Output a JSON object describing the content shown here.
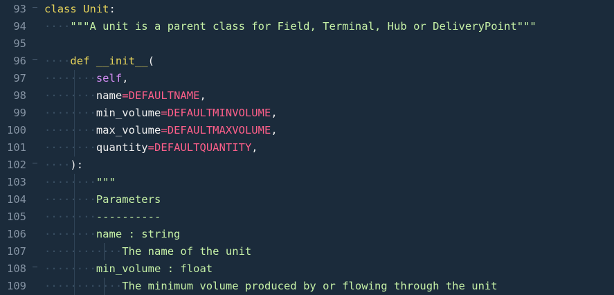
{
  "editor": {
    "lines": [
      {
        "number": "93",
        "fold": true,
        "tokens": [
          {
            "cls": "t-kw",
            "text": "class"
          },
          {
            "cls": "t-name",
            "text": " "
          },
          {
            "cls": "t-cls",
            "text": "Unit"
          },
          {
            "cls": "t-punc",
            "text": ":"
          }
        ]
      },
      {
        "number": "94",
        "fold": false,
        "indent": 1,
        "tokens": [
          {
            "cls": "t-str",
            "text": "\"\"\"A unit is a parent class for Field, Terminal, Hub or DeliveryPoint\"\"\""
          }
        ]
      },
      {
        "number": "95",
        "fold": false,
        "tokens": []
      },
      {
        "number": "96",
        "fold": true,
        "indent": 1,
        "tokens": [
          {
            "cls": "t-def",
            "text": "def"
          },
          {
            "cls": "t-name",
            "text": " "
          },
          {
            "cls": "t-fn",
            "text": "__init__"
          },
          {
            "cls": "t-punc",
            "text": "("
          }
        ]
      },
      {
        "number": "97",
        "fold": false,
        "indent": 2,
        "tokens": [
          {
            "cls": "t-self",
            "text": "self"
          },
          {
            "cls": "t-punc",
            "text": ","
          }
        ]
      },
      {
        "number": "98",
        "fold": false,
        "indent": 2,
        "tokens": [
          {
            "cls": "t-param",
            "text": "name"
          },
          {
            "cls": "t-op",
            "text": "="
          },
          {
            "cls": "t-const",
            "text": "DEFAULTNAME"
          },
          {
            "cls": "t-punc",
            "text": ","
          }
        ]
      },
      {
        "number": "99",
        "fold": false,
        "indent": 2,
        "tokens": [
          {
            "cls": "t-param",
            "text": "min_volume"
          },
          {
            "cls": "t-op",
            "text": "="
          },
          {
            "cls": "t-const",
            "text": "DEFAULTMINVOLUME"
          },
          {
            "cls": "t-punc",
            "text": ","
          }
        ]
      },
      {
        "number": "100",
        "fold": false,
        "indent": 2,
        "tokens": [
          {
            "cls": "t-param",
            "text": "max_volume"
          },
          {
            "cls": "t-op",
            "text": "="
          },
          {
            "cls": "t-const",
            "text": "DEFAULTMAXVOLUME"
          },
          {
            "cls": "t-punc",
            "text": ","
          }
        ]
      },
      {
        "number": "101",
        "fold": false,
        "indent": 2,
        "tokens": [
          {
            "cls": "t-param",
            "text": "quantity"
          },
          {
            "cls": "t-op",
            "text": "="
          },
          {
            "cls": "t-const",
            "text": "DEFAULTQUANTITY"
          },
          {
            "cls": "t-punc",
            "text": ","
          }
        ]
      },
      {
        "number": "102",
        "fold": true,
        "indent": 1,
        "tokens": [
          {
            "cls": "t-punc",
            "text": "):"
          }
        ]
      },
      {
        "number": "103",
        "fold": false,
        "indent": 2,
        "tokens": [
          {
            "cls": "t-doc",
            "text": "\"\"\""
          }
        ]
      },
      {
        "number": "104",
        "fold": false,
        "indent": 2,
        "tokens": [
          {
            "cls": "t-doc",
            "text": "Parameters"
          }
        ]
      },
      {
        "number": "105",
        "fold": false,
        "indent": 2,
        "tokens": [
          {
            "cls": "t-doc",
            "text": "----------"
          }
        ]
      },
      {
        "number": "106",
        "fold": false,
        "indent": 2,
        "tokens": [
          {
            "cls": "t-doc",
            "text": "name : string"
          }
        ]
      },
      {
        "number": "107",
        "fold": false,
        "indent": 3,
        "tokens": [
          {
            "cls": "t-doc",
            "text": "The name of the unit"
          }
        ]
      },
      {
        "number": "108",
        "fold": true,
        "indent": 2,
        "tokens": [
          {
            "cls": "t-doc",
            "text": "min_volume : float"
          }
        ]
      },
      {
        "number": "109",
        "fold": false,
        "indent": 3,
        "tokens": [
          {
            "cls": "t-doc",
            "text": "The minimum volume produced by or flowing through the unit"
          }
        ]
      }
    ]
  }
}
